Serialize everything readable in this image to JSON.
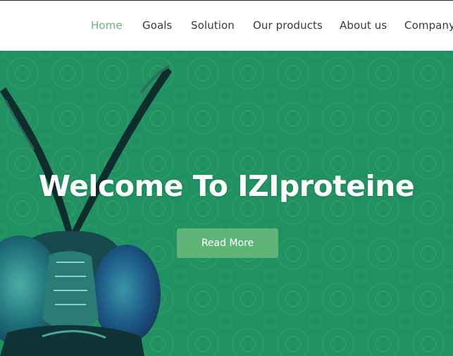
{
  "nav": {
    "items": [
      {
        "label": "Home",
        "active": true
      },
      {
        "label": "Goals",
        "active": false
      },
      {
        "label": "Solution",
        "active": false
      },
      {
        "label": "Our products",
        "active": false
      },
      {
        "label": "About us",
        "active": false
      },
      {
        "label": "Company",
        "active": false
      }
    ]
  },
  "hero": {
    "title": "Welcome To IZIproteine",
    "button_label": "Read More",
    "background_image": "fly-insect-illustration"
  },
  "colors": {
    "accent": "#66b57a",
    "hero_background": "#1f9163",
    "button": "#5fb477",
    "nav_text": "#3a3a3a"
  }
}
